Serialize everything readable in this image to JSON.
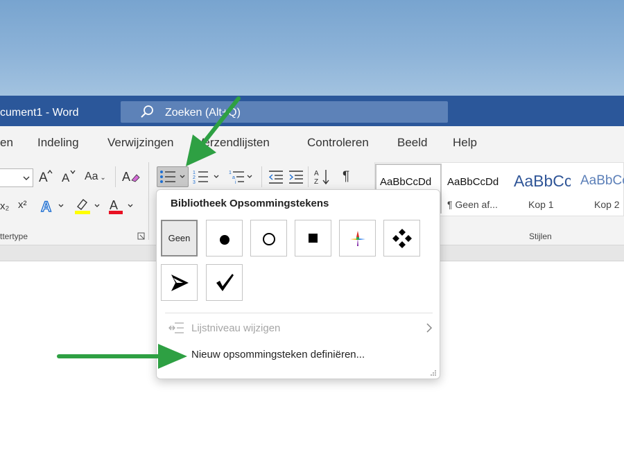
{
  "window": {
    "doc_title": "cument1  -  Word",
    "search_text": "Zoeken (Alt+Q)"
  },
  "menu": {
    "tabs": [
      "en",
      "Indeling",
      "Verwijzingen",
      "Verzendlijsten",
      "Controleren",
      "Beeld",
      "Help"
    ]
  },
  "ribbon": {
    "grow_font": "A^",
    "shrink_font": "A˅",
    "change_case": "Aa",
    "subscript": "x₂",
    "superscript": "x²",
    "font_group_label": "ttertype",
    "styles_group_label": "Stijlen",
    "styles": [
      {
        "sample": "AaBbCcDd",
        "name": ""
      },
      {
        "sample": "AaBbCcDd",
        "name": "¶ Geen af..."
      },
      {
        "sample": "AaBbCc",
        "name": "Kop 1"
      },
      {
        "sample": "AaBbCc",
        "name": "Kop 2"
      }
    ]
  },
  "dropdown": {
    "title": "Bibliotheek Opsommingstekens",
    "none_label": "Geen",
    "bullets": [
      "none",
      "filled-circle",
      "hollow-circle",
      "filled-square",
      "color-star",
      "four-diamonds",
      "arrowhead",
      "checkmark"
    ],
    "list_level_label": "Lijstniveau wijzigen",
    "define_label": "Nieuw opsommingsteken definiëren..."
  },
  "colors": {
    "title_bar": "#2b579a",
    "annotation_arrow": "#2ea043",
    "highlight_yellow": "#ffff00",
    "font_color_red": "#e81123"
  }
}
